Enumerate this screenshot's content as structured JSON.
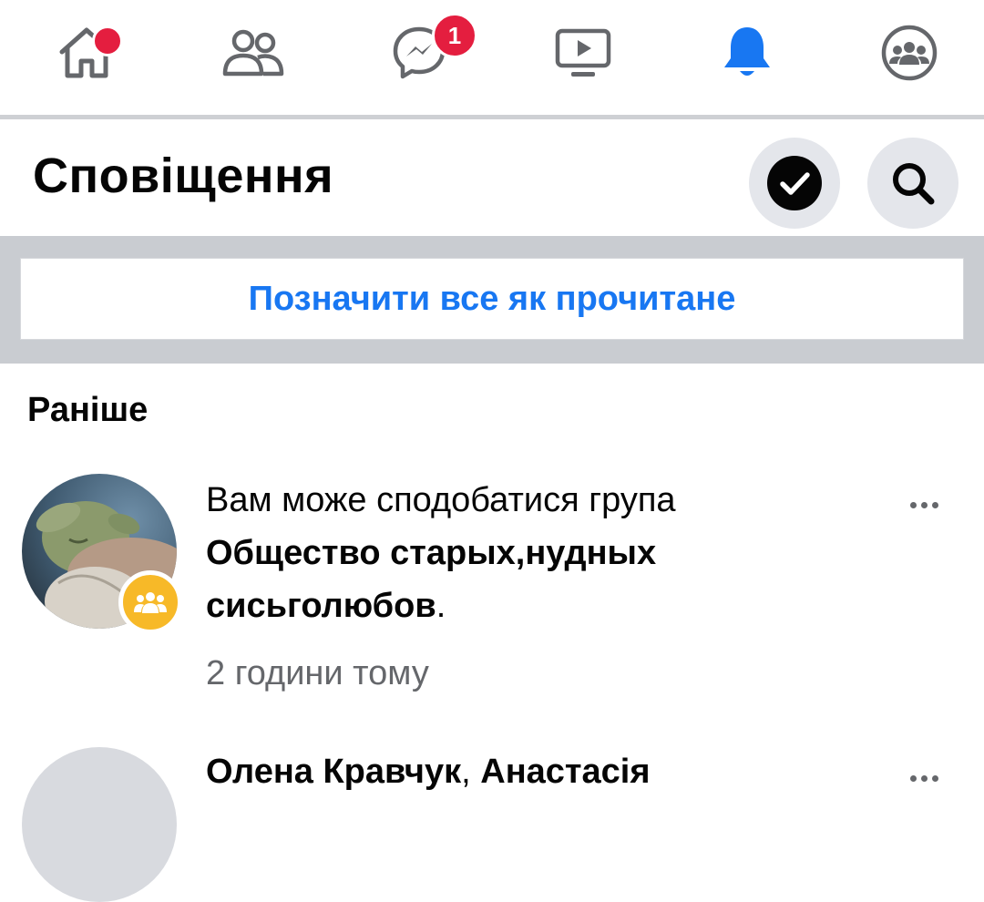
{
  "nav": {
    "items": [
      {
        "name": "home",
        "icon": "home-icon",
        "badge": "dot"
      },
      {
        "name": "friends",
        "icon": "friends-icon"
      },
      {
        "name": "messenger",
        "icon": "messenger-icon",
        "badge_count": "1"
      },
      {
        "name": "watch",
        "icon": "video-icon"
      },
      {
        "name": "notifications",
        "icon": "bell-icon",
        "active": true
      },
      {
        "name": "groups",
        "icon": "groups-icon"
      }
    ],
    "badge_color": "#e41e3f",
    "active_color": "#1877f2"
  },
  "header": {
    "title": "Сповіщення",
    "check_icon": "check-circle-icon",
    "search_icon": "search-icon"
  },
  "mark_all_label": "Позначити все як прочитане",
  "section": {
    "title": "Раніше"
  },
  "notifications": [
    {
      "text_prefix": "Вам може сподобатися група ",
      "text_bold": "Общество старых,нудных сисьголюбов",
      "text_suffix": ".",
      "time": "2 години тому",
      "avatar_badge_icon": "groups-icon",
      "avatar_badge_color": "#f7b928"
    },
    {
      "text_bold": "Олена Кравчук",
      "text_mid": ", ",
      "text_bold_2": "Анастасія"
    }
  ]
}
